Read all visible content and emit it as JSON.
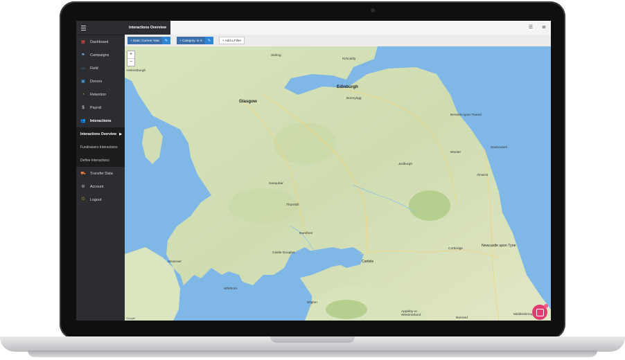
{
  "sidebar": {
    "items": [
      {
        "label": "Dashboard",
        "icon": "dashboard-icon",
        "glyph": "▦",
        "color": "#e84d4d"
      },
      {
        "label": "Campaigns",
        "icon": "flag-icon",
        "glyph": "⚑",
        "color": "#6fa1e8"
      },
      {
        "label": "Field",
        "icon": "monitor-icon",
        "glyph": "▭",
        "color": "#4aa3df"
      },
      {
        "label": "Donors",
        "icon": "donors-icon",
        "glyph": "▣",
        "color": "#4aa3df"
      },
      {
        "label": "Retention",
        "icon": "retention-icon",
        "glyph": "◔",
        "color": "#f0b429"
      },
      {
        "label": "Payroll",
        "icon": "dollar-icon",
        "glyph": "$",
        "color": "#e6e6e6"
      },
      {
        "label": "Interactions",
        "icon": "users-icon",
        "glyph": "👥",
        "color": "#9b8ce0"
      }
    ],
    "subitems": [
      {
        "label": "Interactions Overview"
      },
      {
        "label": "Fundraisers Interactions"
      },
      {
        "label": "Define Interactions"
      }
    ],
    "bottom_items": [
      {
        "label": "Transfer Data",
        "icon": "transfer-icon",
        "glyph": "⛟",
        "color": "#f07c3a"
      },
      {
        "label": "Account",
        "icon": "gear-icon",
        "glyph": "⚙",
        "color": "#bbbbbb"
      },
      {
        "label": "Logout",
        "icon": "logout-icon",
        "glyph": "⎋",
        "color": "#f0b429"
      }
    ]
  },
  "topbar": {
    "title": "Interactions Overview"
  },
  "filters": {
    "chips": [
      {
        "label": "+ Date: Current Year"
      },
      {
        "label": "+ Category: is X"
      }
    ],
    "add_label": "+ Add a Filter"
  },
  "map": {
    "zoom_in": "+",
    "zoom_out": "−",
    "attribution": "Google",
    "places": {
      "stirling": "Stirling",
      "kirkcaldy": "Kirkcaldy",
      "helensburgh": "Helensburgh",
      "edinburgh": "Edinburgh",
      "glasgow": "Glasgow",
      "bonnyrigg": "Bonnyrigg",
      "berwick": "Berwick-upon-Tweed",
      "jedburgh": "Jedburgh",
      "wooler": "Wooler",
      "alnwick": "Alnwick",
      "sanquhar": "Sanquhar",
      "thornhill": "Thornhill",
      "dumfries": "Dumfries",
      "castle_douglas": "Castle Douglas",
      "stranraer": "Stranraer",
      "whithorn": "Whithorn",
      "carlisle": "Carlisle",
      "corbridge": "Corbridge",
      "newcastle": "Newcastle upon Tyne",
      "wigton": "Wigton",
      "appleby": "Appleby-in-Westmorland",
      "barnard": "Barnard",
      "middlesbrough": "Middlesbrough",
      "seahouses": "Seahouses"
    }
  }
}
